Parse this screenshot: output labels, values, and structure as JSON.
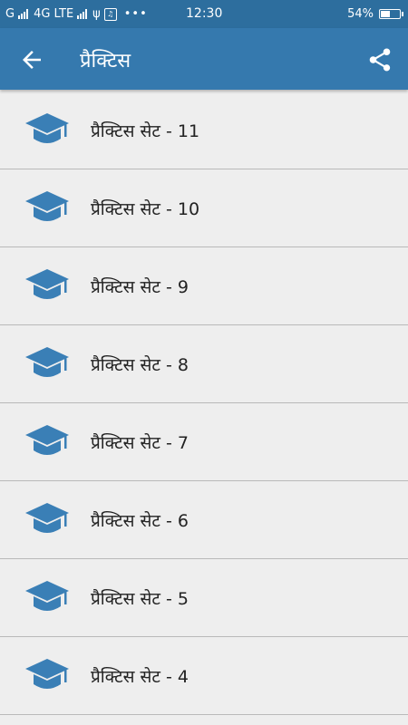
{
  "status_bar": {
    "carrier": "G",
    "network": "4G LTE",
    "time": "12:30",
    "battery": "54%",
    "battery_level": 0.54
  },
  "app_bar": {
    "title": "प्रैक्टिस",
    "back_icon": "arrow-left-icon",
    "share_icon": "share-icon"
  },
  "colors": {
    "status_bar": "#2d6e9e",
    "app_bar": "#3579ae",
    "icon": "#3a7fb6",
    "background": "#eeeeee"
  },
  "items": [
    {
      "label": "प्रैक्टिस सेट - 11",
      "icon": "graduation-cap-icon"
    },
    {
      "label": "प्रैक्टिस सेट - 10",
      "icon": "graduation-cap-icon"
    },
    {
      "label": "प्रैक्टिस सेट - 9",
      "icon": "graduation-cap-icon"
    },
    {
      "label": "प्रैक्टिस सेट - 8",
      "icon": "graduation-cap-icon"
    },
    {
      "label": "प्रैक्टिस सेट - 7",
      "icon": "graduation-cap-icon"
    },
    {
      "label": "प्रैक्टिस सेट - 6",
      "icon": "graduation-cap-icon"
    },
    {
      "label": "प्रैक्टिस सेट - 5",
      "icon": "graduation-cap-icon"
    },
    {
      "label": "प्रैक्टिस सेट - 4",
      "icon": "graduation-cap-icon"
    }
  ]
}
